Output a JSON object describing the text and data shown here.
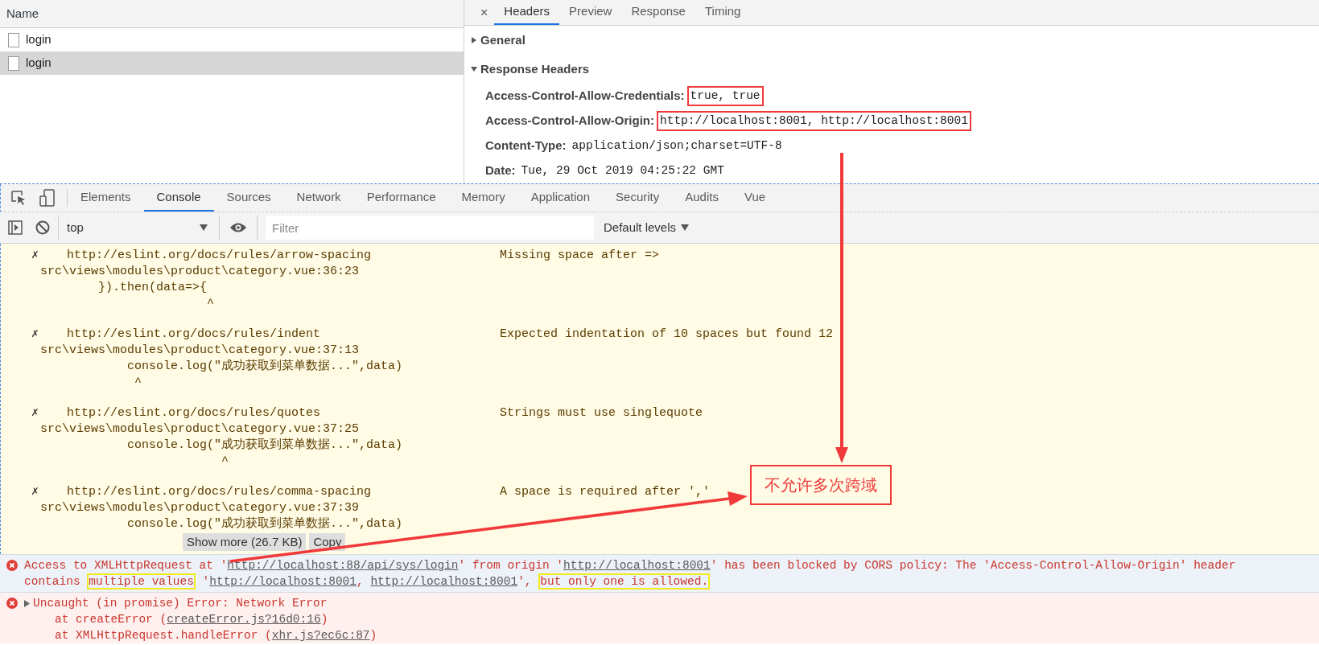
{
  "network": {
    "column_header": "Name",
    "requests": [
      {
        "name": "login",
        "selected": false
      },
      {
        "name": "login",
        "selected": true
      }
    ]
  },
  "detail": {
    "close": "×",
    "tabs": [
      {
        "label": "Headers",
        "selected": true
      },
      {
        "label": "Preview",
        "selected": false
      },
      {
        "label": "Response",
        "selected": false
      },
      {
        "label": "Timing",
        "selected": false
      }
    ],
    "sections": [
      {
        "title": "General",
        "expanded": false
      },
      {
        "title": "Response Headers",
        "expanded": true,
        "headers": [
          {
            "name": "Access-Control-Allow-Credentials:",
            "value": "true, true",
            "annotated": true
          },
          {
            "name": "Access-Control-Allow-Origin:",
            "value": "http://localhost:8001, http://localhost:8001",
            "annotated": true
          },
          {
            "name": "Content-Type:",
            "value": "application/json;charset=UTF-8",
            "annotated": false
          },
          {
            "name": "Date:",
            "value": "Tue, 29 Oct 2019 04:25:22 GMT",
            "annotated": false
          }
        ]
      }
    ]
  },
  "devtools": {
    "tabs": [
      {
        "label": "Elements",
        "selected": false
      },
      {
        "label": "Console",
        "selected": true
      },
      {
        "label": "Sources",
        "selected": false
      },
      {
        "label": "Network",
        "selected": false
      },
      {
        "label": "Performance",
        "selected": false
      },
      {
        "label": "Memory",
        "selected": false
      },
      {
        "label": "Application",
        "selected": false
      },
      {
        "label": "Security",
        "selected": false
      },
      {
        "label": "Audits",
        "selected": false
      },
      {
        "label": "Vue",
        "selected": false
      }
    ],
    "toolbar": {
      "context": "top",
      "filter_placeholder": "Filter",
      "levels": "Default levels"
    }
  },
  "console": {
    "lint_messages": [
      {
        "mark": "✗",
        "url": "http://eslint.org/docs/rules/arrow-spacing",
        "message": "Missing space after =>",
        "file": "src\\views\\modules\\product\\category.vue:36:23",
        "code": "        }).then(data=>{",
        "caret": "                       ^"
      },
      {
        "mark": "✗",
        "url": "http://eslint.org/docs/rules/indent",
        "message": "Expected indentation of 10 spaces but found 12",
        "file": "src\\views\\modules\\product\\category.vue:37:13",
        "code": "            console.log(\"成功获取到菜单数据...\",data)",
        "caret": "             ^"
      },
      {
        "mark": "✗",
        "url": "http://eslint.org/docs/rules/quotes",
        "message": "Strings must use singlequote",
        "file": "src\\views\\modules\\product\\category.vue:37:25",
        "code": "            console.log(\"成功获取到菜单数据...\",data)",
        "caret": "                         ^"
      },
      {
        "mark": "✗",
        "url": "http://eslint.org/docs/rules/comma-spacing",
        "message": "A space is required after ','",
        "file": "src\\views\\modules\\product\\category.vue:37:39",
        "code": "            console.log(\"成功获取到菜单数据...\",data)",
        "show_more": "Show more (26.7 KB)",
        "copy": "Copy"
      }
    ],
    "errors": [
      {
        "kind": "cors",
        "lines": [
          [
            {
              "text": "Access to XMLHttpRequest at '"
            },
            {
              "text": "http://localhost:88/api/sys/login",
              "link": true
            },
            {
              "text": "' from origin '"
            },
            {
              "text": "http://localhost:8001",
              "link": true
            },
            {
              "text": "' has been blocked by CORS policy: The 'Access-Control-Allow-Origin' header"
            }
          ],
          [
            {
              "text": "contains "
            },
            {
              "text": "multiple values",
              "highlight": true
            },
            {
              "text": " '"
            },
            {
              "text": "http://localhost:8001",
              "link": true
            },
            {
              "text": ", "
            },
            {
              "text": "http://localhost:8001",
              "link": true
            },
            {
              "text": "', "
            },
            {
              "text": "but only one is allowed.",
              "highlight": true
            }
          ]
        ]
      },
      {
        "kind": "uncaught",
        "expanded": false,
        "summary": "Uncaught (in promise) Error: Network Error",
        "stack": [
          {
            "prefix": "at createError (",
            "link": "createError.js?16d0:16",
            "suffix": ")"
          },
          {
            "prefix": "at XMLHttpRequest.handleError (",
            "link": "xhr.js?ec6c:87",
            "suffix": ")"
          }
        ]
      }
    ]
  },
  "annotation": {
    "callout": "不允许多次跨域"
  }
}
